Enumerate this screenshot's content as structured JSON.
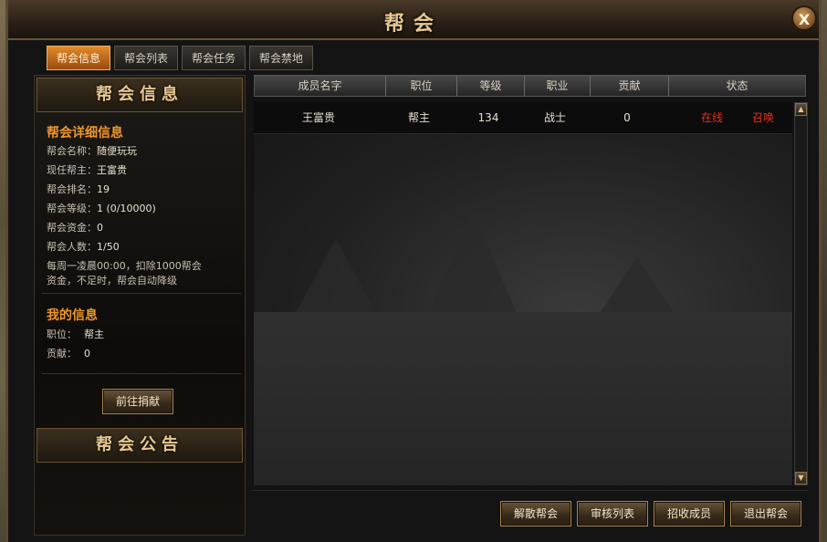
{
  "window": {
    "title": "帮会",
    "close_label": "X"
  },
  "tabs": [
    {
      "label": "帮会信息",
      "active": true
    },
    {
      "label": "帮会列表",
      "active": false
    },
    {
      "label": "帮会任务",
      "active": false
    },
    {
      "label": "帮会禁地",
      "active": false
    }
  ],
  "left": {
    "header": "帮会信息",
    "detail_title": "帮会详细信息",
    "fields": [
      {
        "label": "帮会名称：",
        "value": "随便玩玩"
      },
      {
        "label": "现任帮主：",
        "value": "王富贵"
      },
      {
        "label": "帮会排名：",
        "value": "19"
      },
      {
        "label": "帮会等级：",
        "value": "1 (0/10000)"
      },
      {
        "label": "帮会资金：",
        "value": "0"
      },
      {
        "label": "帮会人数：",
        "value": "1/50"
      }
    ],
    "notice_line1": "每周一凌晨00:00，扣除1000帮会",
    "notice_line2": "资金，不足时，帮会自动降级",
    "my_title": "我的信息",
    "my_fields": [
      {
        "label": "职位：",
        "value": "帮主"
      },
      {
        "label": "贡献：",
        "value": "0"
      }
    ],
    "donate_button": "前往捐献",
    "announce_header": "帮会公告"
  },
  "table": {
    "headers": [
      "成员名字",
      "职位",
      "等级",
      "职业",
      "贡献",
      "状态"
    ],
    "rows": [
      {
        "name": "王富贵",
        "position": "帮主",
        "level": "134",
        "job": "战士",
        "contribution": "0",
        "status": "在线",
        "action": "召唤"
      }
    ]
  },
  "buttons": {
    "disband": "解散帮会",
    "review": "审核列表",
    "recruit": "招收成员",
    "quit": "退出帮会"
  },
  "colors": {
    "accent_orange": "#f0962a",
    "online_red": "#e03020",
    "gold_text": "#e8c890"
  }
}
